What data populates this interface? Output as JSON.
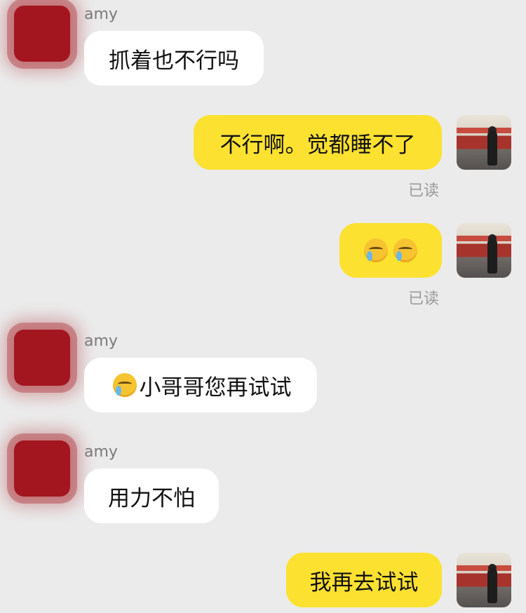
{
  "messages": [
    {
      "side": "left",
      "name": "amy",
      "text": "抓着也不行吗"
    },
    {
      "side": "right",
      "text": "不行啊。觉都睡不了",
      "status": "已读"
    },
    {
      "side": "right",
      "emoji": [
        "crying-face-emoji",
        "crying-face-emoji"
      ],
      "status": "已读"
    },
    {
      "side": "left",
      "name": "amy",
      "emoji": [
        "crying-face-emoji"
      ],
      "text": "小哥哥您再试试"
    },
    {
      "side": "left",
      "name": "amy",
      "text": "用力不怕"
    },
    {
      "side": "right",
      "text": "我再去试试"
    }
  ]
}
